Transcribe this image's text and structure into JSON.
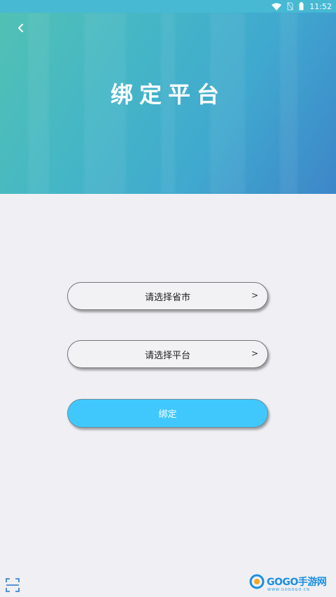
{
  "status_bar": {
    "time": "11:52",
    "icons": [
      "wifi-icon",
      "no-sim-icon",
      "battery-icon"
    ],
    "color": "#47b9d3"
  },
  "header": {
    "title": "绑定平台",
    "back_icon": "chevron-left-icon",
    "gradient": [
      "#51c1b4",
      "#45b6c6",
      "#40a9cf",
      "#3d86c9"
    ]
  },
  "form": {
    "province_city_select": {
      "label": "请选择省市",
      "chevron": ">"
    },
    "platform_select": {
      "label": "请选择平台",
      "chevron": ">"
    },
    "bind_button": {
      "label": "绑定",
      "color": "#40c8fc"
    }
  },
  "footer": {
    "scan_icon": "scan-icon",
    "watermark": {
      "text": "GOGO手游网",
      "sub": "WWW.GOGOGO.CN"
    }
  }
}
